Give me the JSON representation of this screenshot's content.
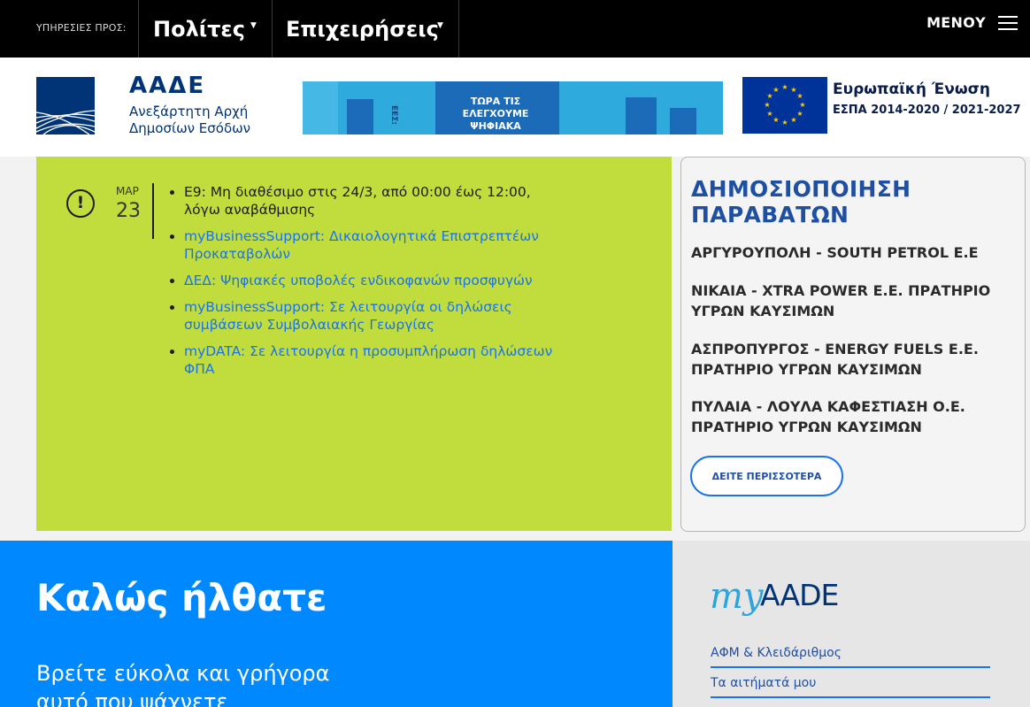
{
  "topbar": {
    "services_label": "ΥΠΗΡΕΣΙΕΣ ΠΡΟΣ:",
    "nav": [
      "Πολίτες",
      "Επιχειρήσεις"
    ],
    "menu_label": "ΜΕΝΟΥ"
  },
  "header": {
    "logo_main": "ΑΑΔΕ",
    "logo_sub1": "Ανεξάρτητη Αρχή",
    "logo_sub2": "Δημοσίων Εσόδων",
    "banner_text": "ΤΩΡΑ ΤΙΣ ΕΛΕΓΧΟΥΜΕ ΨΗΦΙΑΚΑ",
    "banner_side_text": "ΕΕΣ:",
    "eu_line1": "Ευρωπαϊκή Ένωση",
    "eu_line2": "ΕΣΠΑ 2014-2020 / 2021-2027"
  },
  "news": {
    "icon": "exclamation-circle-icon",
    "month": "ΜΑΡ",
    "day": "23",
    "items": [
      {
        "text": "Ε9: Μη διαθέσιμο στις 24/3, από 00:00 έως 12:00, λόγω αναβάθμισης",
        "link": false
      },
      {
        "text": "myBusinessSupport: Δικαιολογητικά Επιστρεπτέων Προκαταβολών",
        "link": true
      },
      {
        "text": "ΔΕΔ: Ψηφιακές υποβολές ενδικοφανών προσφυγών",
        "link": true
      },
      {
        "text": "myBusinessSupport: Σε λειτουργία οι δηλώσεις συμβάσεων Συμβολαιακής Γεωργίας",
        "link": true
      },
      {
        "text": "myDATA: Σε λειτουργία η  προσυμπλήρωση δηλώσεων ΦΠΑ",
        "link": true
      }
    ]
  },
  "violators": {
    "title": "ΔΗΜΟΣΙΟΠΟΙΗΣΗ ΠΑΡΑΒΑΤΩΝ",
    "items": [
      "ΑΡΓΥΡΟΥΠΟΛΗ - SOUTH PETROL Ε.Ε",
      "ΝΙΚΑΙΑ - XTRA POWER Ε.Ε. ΠΡΑΤΗΡΙΟ ΥΓΡΩΝ ΚΑΥΣΙΜΩΝ",
      "ΑΣΠΡΟΠΥΡΓΟΣ - ENERGY FUELS Ε.Ε. ΠΡΑΤΗΡΙΟ ΥΓΡΩΝ ΚΑΥΣΙΜΩΝ",
      "ΠΥΛΑΙΑ - ΛΟΥΛΑ ΚΑΦΕΣΤΙΑΣΗ Ο.Ε. ΠΡΑΤΗΡΙΟ ΥΓΡΩΝ ΚΑΥΣΙΜΩΝ"
    ],
    "more_button": "ΔΕΙΤΕ ΠΕΡΙΣΣΟΤΕΡΑ"
  },
  "welcome": {
    "title": "Καλώς ήλθατε",
    "subtitle": "Βρείτε εύκολα και γρήγορα αυτό που ψάχνετε"
  },
  "myaade": {
    "logo_my": "my",
    "logo_aade": "AADE",
    "links": [
      "ΑΦΜ & Κλειδάριθμος",
      "Τα αιτήματά μου"
    ]
  },
  "colors": {
    "brand_navy": "#003476",
    "news_green": "#c1dd3d",
    "welcome_blue": "#0088ff",
    "link_blue": "#1a73e8",
    "title_blue": "#1f4fa0"
  }
}
